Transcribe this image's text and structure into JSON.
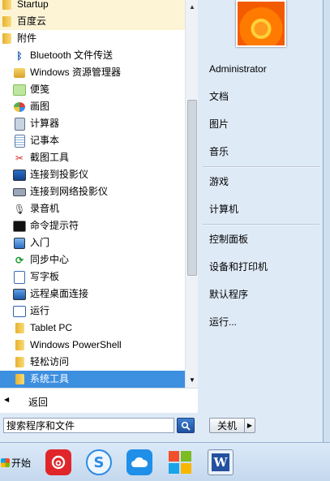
{
  "programs": {
    "items": [
      {
        "label": "Startup",
        "icon": "folder-icon"
      },
      {
        "label": "百度云",
        "icon": "folder-icon"
      },
      {
        "label": "附件",
        "icon": "folder-icon"
      },
      {
        "label": "Bluetooth 文件传送",
        "icon": "bluetooth-icon"
      },
      {
        "label": "Windows 资源管理器",
        "icon": "explorer-icon"
      },
      {
        "label": "便笺",
        "icon": "sticky-notes-icon"
      },
      {
        "label": "画图",
        "icon": "paint-icon"
      },
      {
        "label": "计算器",
        "icon": "calculator-icon"
      },
      {
        "label": "记事本",
        "icon": "notepad-icon"
      },
      {
        "label": "截图工具",
        "icon": "snipping-tool-icon"
      },
      {
        "label": "连接到投影仪",
        "icon": "projector-icon"
      },
      {
        "label": "连接到网络投影仪",
        "icon": "network-projector-icon"
      },
      {
        "label": "录音机",
        "icon": "sound-recorder-icon"
      },
      {
        "label": "命令提示符",
        "icon": "command-prompt-icon"
      },
      {
        "label": "入门",
        "icon": "getting-started-icon"
      },
      {
        "label": "同步中心",
        "icon": "sync-center-icon"
      },
      {
        "label": "写字板",
        "icon": "wordpad-icon"
      },
      {
        "label": "远程桌面连接",
        "icon": "remote-desktop-icon"
      },
      {
        "label": "运行",
        "icon": "run-icon"
      },
      {
        "label": "Tablet PC",
        "icon": "folder-icon"
      },
      {
        "label": "Windows PowerShell",
        "icon": "folder-icon"
      },
      {
        "label": "轻松访问",
        "icon": "folder-icon"
      },
      {
        "label": "系统工具",
        "icon": "folder-icon"
      }
    ],
    "selected_index": 22,
    "back_label": "返回"
  },
  "search": {
    "placeholder": "搜索程序和文件"
  },
  "right_pane": {
    "user": "Administrator",
    "links": [
      "文档",
      "图片",
      "音乐",
      "游戏",
      "计算机",
      "控制面板",
      "设备和打印机",
      "默认程序",
      "运行..."
    ]
  },
  "shutdown": {
    "label": "关机"
  },
  "taskbar": {
    "start_label": "开始",
    "apps": [
      "netease-music-icon",
      "sogou-input-icon",
      "baidu-cloud-icon",
      "tile-app-icon",
      "word-icon"
    ]
  },
  "colors": {
    "selection": "#3d8fe0",
    "menu_bg": "#dfeaf7"
  }
}
